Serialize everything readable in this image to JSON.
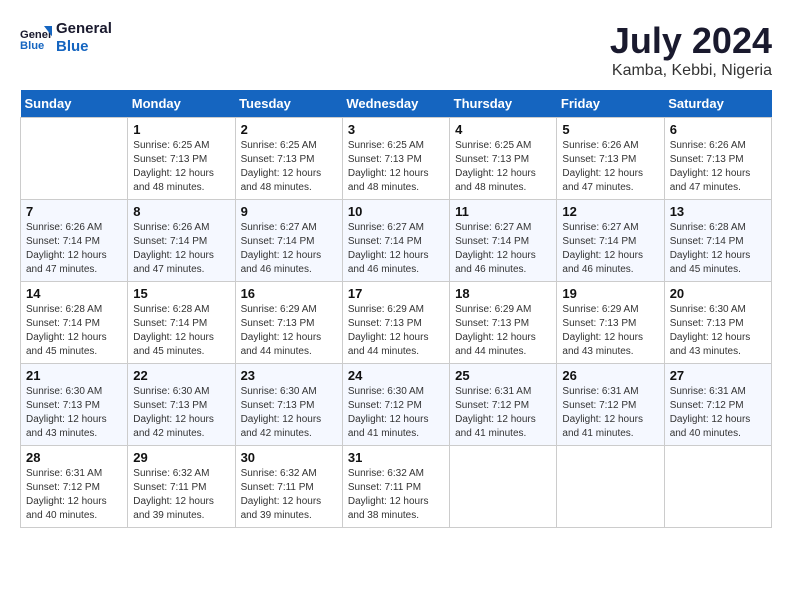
{
  "header": {
    "logo_line1": "General",
    "logo_line2": "Blue",
    "month_year": "July 2024",
    "location": "Kamba, Kebbi, Nigeria"
  },
  "weekdays": [
    "Sunday",
    "Monday",
    "Tuesday",
    "Wednesday",
    "Thursday",
    "Friday",
    "Saturday"
  ],
  "weeks": [
    [
      {
        "day": "",
        "sunrise": "",
        "sunset": "",
        "daylight": ""
      },
      {
        "day": "1",
        "sunrise": "6:25 AM",
        "sunset": "7:13 PM",
        "daylight": "12 hours and 48 minutes."
      },
      {
        "day": "2",
        "sunrise": "6:25 AM",
        "sunset": "7:13 PM",
        "daylight": "12 hours and 48 minutes."
      },
      {
        "day": "3",
        "sunrise": "6:25 AM",
        "sunset": "7:13 PM",
        "daylight": "12 hours and 48 minutes."
      },
      {
        "day": "4",
        "sunrise": "6:25 AM",
        "sunset": "7:13 PM",
        "daylight": "12 hours and 48 minutes."
      },
      {
        "day": "5",
        "sunrise": "6:26 AM",
        "sunset": "7:13 PM",
        "daylight": "12 hours and 47 minutes."
      },
      {
        "day": "6",
        "sunrise": "6:26 AM",
        "sunset": "7:13 PM",
        "daylight": "12 hours and 47 minutes."
      }
    ],
    [
      {
        "day": "7",
        "sunrise": "6:26 AM",
        "sunset": "7:14 PM",
        "daylight": "12 hours and 47 minutes."
      },
      {
        "day": "8",
        "sunrise": "6:26 AM",
        "sunset": "7:14 PM",
        "daylight": "12 hours and 47 minutes."
      },
      {
        "day": "9",
        "sunrise": "6:27 AM",
        "sunset": "7:14 PM",
        "daylight": "12 hours and 46 minutes."
      },
      {
        "day": "10",
        "sunrise": "6:27 AM",
        "sunset": "7:14 PM",
        "daylight": "12 hours and 46 minutes."
      },
      {
        "day": "11",
        "sunrise": "6:27 AM",
        "sunset": "7:14 PM",
        "daylight": "12 hours and 46 minutes."
      },
      {
        "day": "12",
        "sunrise": "6:27 AM",
        "sunset": "7:14 PM",
        "daylight": "12 hours and 46 minutes."
      },
      {
        "day": "13",
        "sunrise": "6:28 AM",
        "sunset": "7:14 PM",
        "daylight": "12 hours and 45 minutes."
      }
    ],
    [
      {
        "day": "14",
        "sunrise": "6:28 AM",
        "sunset": "7:14 PM",
        "daylight": "12 hours and 45 minutes."
      },
      {
        "day": "15",
        "sunrise": "6:28 AM",
        "sunset": "7:14 PM",
        "daylight": "12 hours and 45 minutes."
      },
      {
        "day": "16",
        "sunrise": "6:29 AM",
        "sunset": "7:13 PM",
        "daylight": "12 hours and 44 minutes."
      },
      {
        "day": "17",
        "sunrise": "6:29 AM",
        "sunset": "7:13 PM",
        "daylight": "12 hours and 44 minutes."
      },
      {
        "day": "18",
        "sunrise": "6:29 AM",
        "sunset": "7:13 PM",
        "daylight": "12 hours and 44 minutes."
      },
      {
        "day": "19",
        "sunrise": "6:29 AM",
        "sunset": "7:13 PM",
        "daylight": "12 hours and 43 minutes."
      },
      {
        "day": "20",
        "sunrise": "6:30 AM",
        "sunset": "7:13 PM",
        "daylight": "12 hours and 43 minutes."
      }
    ],
    [
      {
        "day": "21",
        "sunrise": "6:30 AM",
        "sunset": "7:13 PM",
        "daylight": "12 hours and 43 minutes."
      },
      {
        "day": "22",
        "sunrise": "6:30 AM",
        "sunset": "7:13 PM",
        "daylight": "12 hours and 42 minutes."
      },
      {
        "day": "23",
        "sunrise": "6:30 AM",
        "sunset": "7:13 PM",
        "daylight": "12 hours and 42 minutes."
      },
      {
        "day": "24",
        "sunrise": "6:30 AM",
        "sunset": "7:12 PM",
        "daylight": "12 hours and 41 minutes."
      },
      {
        "day": "25",
        "sunrise": "6:31 AM",
        "sunset": "7:12 PM",
        "daylight": "12 hours and 41 minutes."
      },
      {
        "day": "26",
        "sunrise": "6:31 AM",
        "sunset": "7:12 PM",
        "daylight": "12 hours and 41 minutes."
      },
      {
        "day": "27",
        "sunrise": "6:31 AM",
        "sunset": "7:12 PM",
        "daylight": "12 hours and 40 minutes."
      }
    ],
    [
      {
        "day": "28",
        "sunrise": "6:31 AM",
        "sunset": "7:12 PM",
        "daylight": "12 hours and 40 minutes."
      },
      {
        "day": "29",
        "sunrise": "6:32 AM",
        "sunset": "7:11 PM",
        "daylight": "12 hours and 39 minutes."
      },
      {
        "day": "30",
        "sunrise": "6:32 AM",
        "sunset": "7:11 PM",
        "daylight": "12 hours and 39 minutes."
      },
      {
        "day": "31",
        "sunrise": "6:32 AM",
        "sunset": "7:11 PM",
        "daylight": "12 hours and 38 minutes."
      },
      {
        "day": "",
        "sunrise": "",
        "sunset": "",
        "daylight": ""
      },
      {
        "day": "",
        "sunrise": "",
        "sunset": "",
        "daylight": ""
      },
      {
        "day": "",
        "sunrise": "",
        "sunset": "",
        "daylight": ""
      }
    ]
  ]
}
